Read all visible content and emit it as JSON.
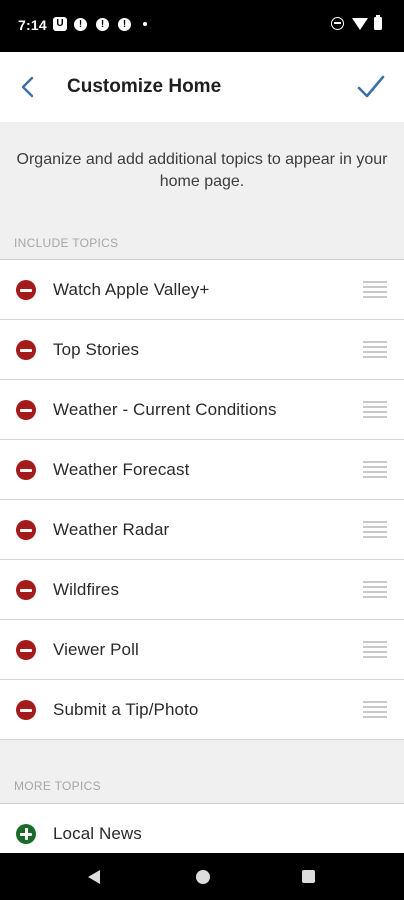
{
  "status_bar": {
    "time": "7:14",
    "left_icons": [
      "u-app-icon",
      "alert-icon",
      "alert-icon",
      "alert-icon",
      "dot-icon"
    ],
    "right_icons": [
      "do-not-disturb-icon",
      "wifi-icon",
      "battery-icon"
    ]
  },
  "header": {
    "title": "Customize Home",
    "back_icon": "chevron-left-icon",
    "done_icon": "checkmark-icon",
    "accent_color": "#3d6fa8"
  },
  "intro": {
    "text": "Organize and add additional topics to appear in your home page."
  },
  "include_section": {
    "label": "INCLUDE TOPICS",
    "items": [
      {
        "label": "Watch Apple Valley+"
      },
      {
        "label": "Top Stories"
      },
      {
        "label": "Weather - Current Conditions"
      },
      {
        "label": "Weather Forecast"
      },
      {
        "label": "Weather Radar"
      },
      {
        "label": "Wildfires"
      },
      {
        "label": "Viewer Poll"
      },
      {
        "label": "Submit a Tip/Photo"
      }
    ],
    "remove_color": "#a31b1b"
  },
  "more_section": {
    "label": "MORE TOPICS",
    "items": [
      {
        "label": "Local News"
      }
    ],
    "add_color": "#1c6b2a"
  },
  "nav_bar": {
    "icons": [
      "back-triangle-icon",
      "home-circle-icon",
      "recents-square-icon"
    ]
  }
}
